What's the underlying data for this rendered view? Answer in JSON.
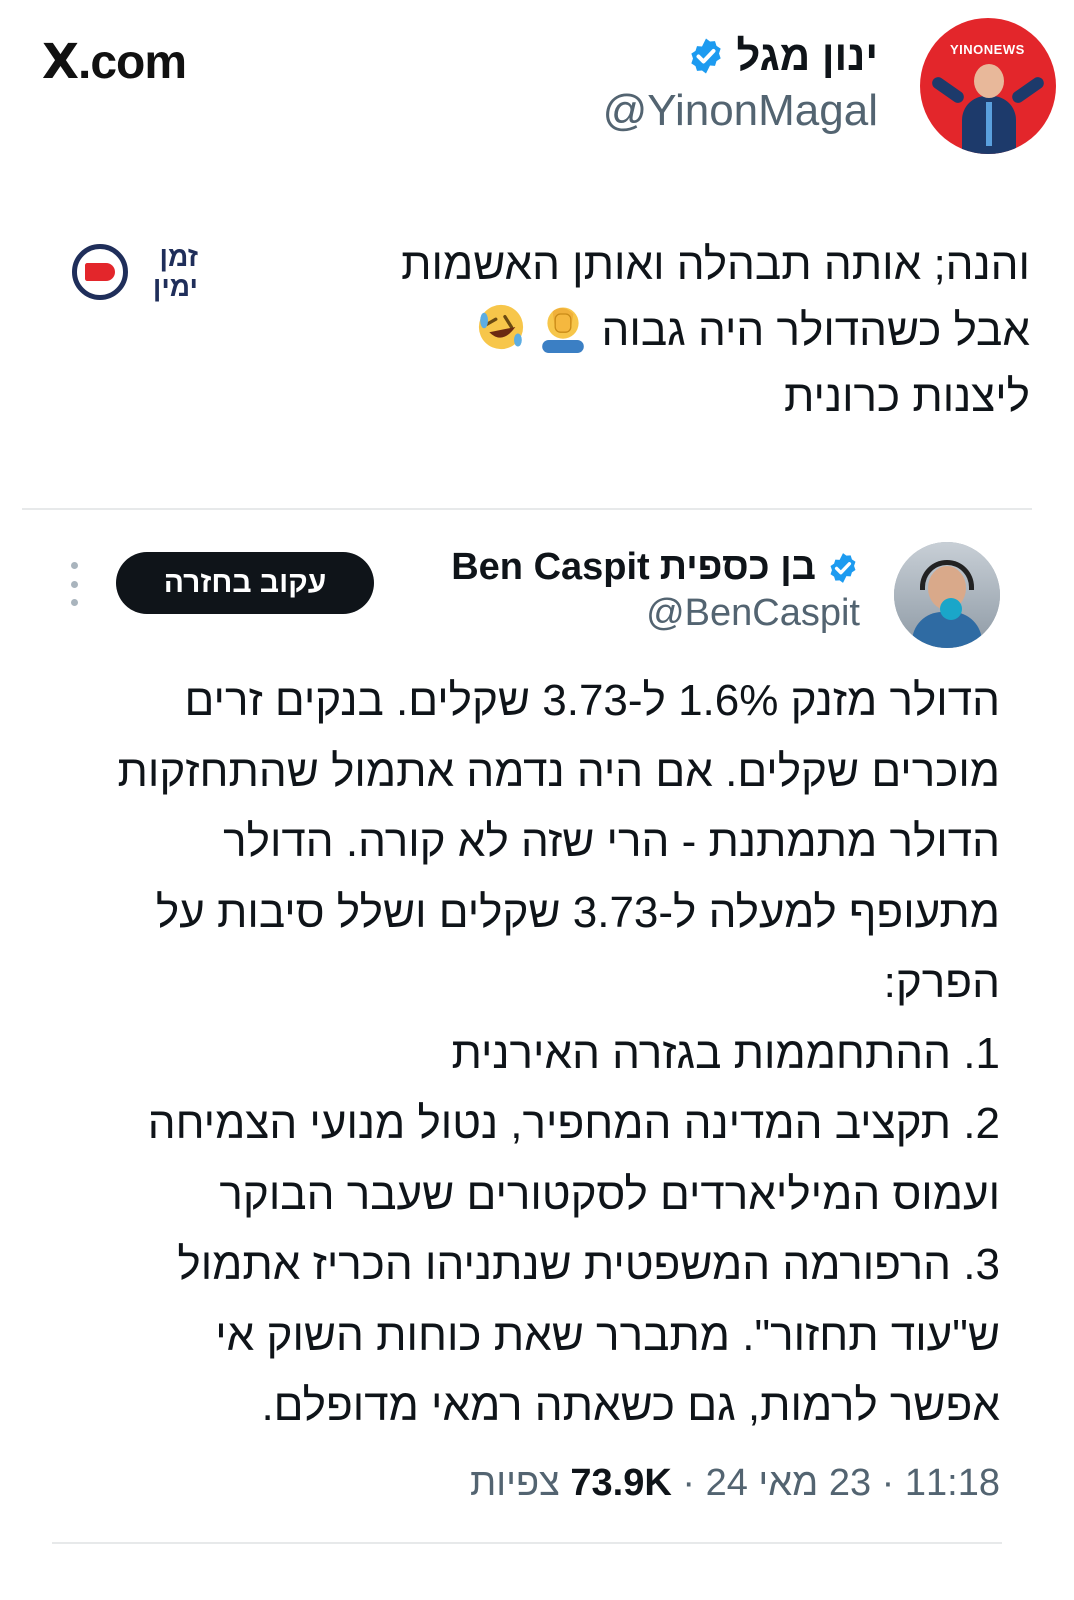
{
  "brand": {
    "logo": "X",
    "suffix": ".com"
  },
  "author": {
    "name": "ינון מגל",
    "handle": "@YinonMagal",
    "avatar_label": "YINONEWS",
    "verified": true
  },
  "tweet": {
    "lines": [
      "והנה; אותה תבהלה ואותן האשמות",
      "אבל כשהדולר היה גבוה",
      "ליצנות כרונית"
    ],
    "emojis": [
      "face-palm-icon",
      "rolling-laughing-icon"
    ]
  },
  "watermark": {
    "text_line1": "זמן",
    "text_line2": "ימין"
  },
  "quoted": {
    "name_hebrew": "בן כספית",
    "name_latin": "Ben Caspit",
    "handle": "@BenCaspit",
    "follow_label": "עקוב בחזרה",
    "lines": [
      "הדולר מזנק 1.6% ל-3.73 שקלים. בנקים זרים",
      "מוכרים שקלים. אם היה נדמה אתמול שהתחזקות",
      "הדולר מתמתנת - הרי שזה לא קורה. הדולר",
      "מתעופף למעלה ל-3.73 שקלים ושלל סיבות על",
      "הפרק:",
      "1. ההתחממות בגזרה האירנית",
      "2. תקציב המדינה המחפיר, נטול מנועי הצמיחה",
      "ועמוס המיליארדים לסקטורים שעבר הבוקר",
      "3. הרפורמה המשפטית שנתניהו הכריז אתמול",
      "ש\"עוד תחזור\". מתברר שאת כוחות השוק אי",
      "אפשר לרמות, גם כשאתה רמאי מדופלם."
    ],
    "time": "11:18",
    "date": "23 מאי 24",
    "views_count": "73.9K",
    "views_label": "צפיות"
  },
  "colors": {
    "verified": "#1d9bf0",
    "muted": "#536471",
    "text": "#0f1419",
    "brand_red": "#e3262b"
  }
}
